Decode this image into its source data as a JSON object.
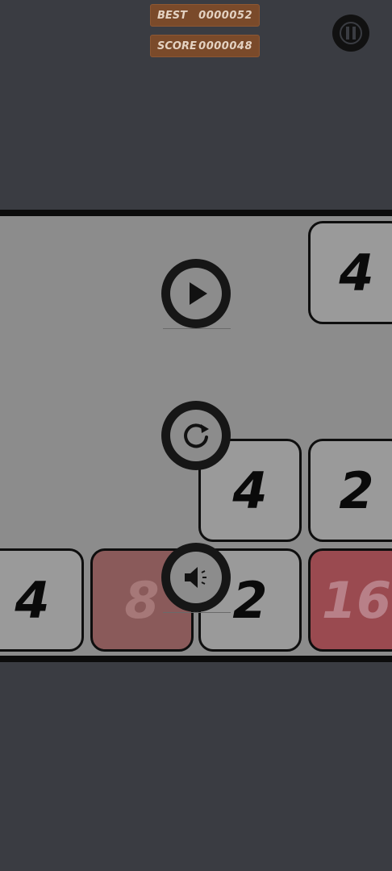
{
  "hud": {
    "best_label": "BEST",
    "best_value": "0000052",
    "score_label": "SCORE",
    "score_value": "0000048"
  },
  "board": {
    "tiles": [
      {
        "value": "4",
        "style": "plain"
      },
      {
        "value": "4",
        "style": "plain"
      },
      {
        "value": "2",
        "style": "plain"
      },
      {
        "value": "4",
        "style": "plain"
      },
      {
        "value": "8",
        "style": "red"
      },
      {
        "value": "2",
        "style": "plain"
      },
      {
        "value": "16",
        "style": "red"
      }
    ]
  },
  "pause_menu": {
    "buttons": [
      "play-icon",
      "restart-icon",
      "sound-icon"
    ]
  },
  "icons": {
    "pause": "pause-icon"
  },
  "colors": {
    "background": "#3a3c42",
    "hud_box": "#7a4a2a",
    "board_overlay": "#8c8c8c"
  }
}
